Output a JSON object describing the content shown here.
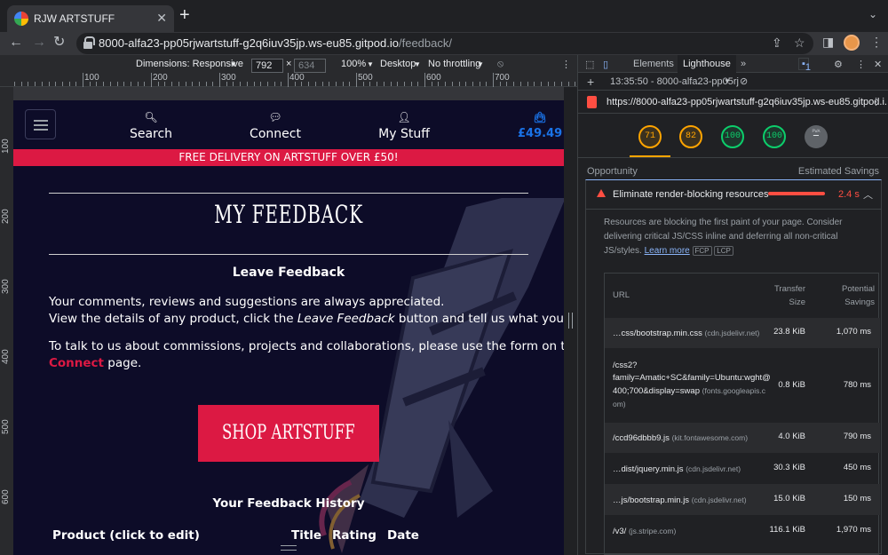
{
  "browser": {
    "tab_title": "RJW ARTSTUFF",
    "tab_close": "✕",
    "new_tab": "+",
    "url_host": "8000-alfa23-pp05rjwartstuff-g2q6iuv35jp.ws-eu85.gitpod.io",
    "url_path": "/feedback/"
  },
  "device_toolbar": {
    "dimensions_label": "Dimensions: Responsive",
    "width": "792",
    "height": "634",
    "times": "×",
    "zoom": "100%",
    "device_type": "Desktop",
    "throttling": "No throttling"
  },
  "rulers": {
    "h_labels": [
      "100",
      "200",
      "300",
      "400",
      "500",
      "600",
      "700"
    ],
    "v_labels": [
      "100",
      "200",
      "300",
      "400",
      "500",
      "600"
    ]
  },
  "devtools": {
    "tabs": [
      "Elements",
      "Lighthouse"
    ],
    "more": "»",
    "issues_count": "1",
    "report_time": "13:35:50 - 8000-alfa23-pp05rj",
    "report_url": "https://8000-alfa23-pp05rjwartstuff-g2q6iuv35jp.ws-eu85.gitpod.i...",
    "scores": [
      "71",
      "82",
      "100",
      "100"
    ],
    "pwa_label": "PWA",
    "opportunity_label": "Opportunity",
    "estimated_savings_label": "Estimated Savings",
    "audit": {
      "title": "Eliminate render-blocking resources",
      "savings": "2.4 s",
      "description": "Resources are blocking the first paint of your page. Consider delivering critical JS/CSS inline and deferring all non-critical JS/styles.",
      "learn_more": "Learn more",
      "tags": [
        "FCP",
        "LCP"
      ],
      "table_headers": {
        "url": "URL",
        "transfer_1": "Transfer",
        "transfer_2": "Size",
        "savings_1": "Potential",
        "savings_2": "Savings"
      },
      "rows": [
        {
          "url": "…css/bootstrap.min.css",
          "host": "(cdn.jsdelivr.net)",
          "size": "23.8 KiB",
          "savings": "1,070 ms"
        },
        {
          "url_l1": "/css2?",
          "url_l2": "family=Amatic+SC&family=Ubuntu:wght@",
          "url_l3": "400;700&display=swap",
          "host": "(fonts.googleapis.c",
          "host_l2": "om)",
          "size": "0.8 KiB",
          "savings": "780 ms"
        },
        {
          "url": "/ccd96dbbb9.js",
          "host": "(kit.fontawesome.com)",
          "size": "4.0 KiB",
          "savings": "790 ms"
        },
        {
          "url": "…dist/jquery.min.js",
          "host": "(cdn.jsdelivr.net)",
          "size": "30.3 KiB",
          "savings": "450 ms"
        },
        {
          "url": "…js/bootstrap.min.js",
          "host": "(cdn.jsdelivr.net)",
          "size": "15.0 KiB",
          "savings": "150 ms"
        },
        {
          "url": "/v3/",
          "host": "(js.stripe.com)",
          "size": "116.1 KiB",
          "savings": "1,970 ms"
        }
      ]
    }
  },
  "site": {
    "nav": [
      {
        "label": "Search",
        "icon": "search-icon"
      },
      {
        "label": "Connect",
        "icon": "chat-icon"
      },
      {
        "label": "My Stuff",
        "icon": "user-icon"
      }
    ],
    "bag_total": "£49.49",
    "banner": "FREE DELIVERY ON ARTSTUFF OVER £50!",
    "title": "MY FEEDBACK",
    "subtitle": "Leave Feedback",
    "p1_line1": "Your comments, reviews and suggestions are always appreciated.",
    "p1_line2a": "View the details of any product, click the ",
    "p1_line2_em": "Leave Feedback",
    "p1_line2b": " button and tell us what you think!",
    "p2_line1": "To talk to us about commissions, projects and collaborations, please use the form on the",
    "p2_link": "Connect",
    "p2_line2b": " page.",
    "shop_button": "SHOP ARTSTUFF",
    "history_title": "Your Feedback History",
    "columns": [
      "Product (click to edit)",
      "Title",
      "Rating",
      "Date"
    ]
  },
  "colors": {
    "accent_red": "#dc1943",
    "navy": "#0d0c28",
    "lh_orange": "#ffa400",
    "lh_green": "#0cce6b",
    "lh_red": "#ff4e42"
  }
}
